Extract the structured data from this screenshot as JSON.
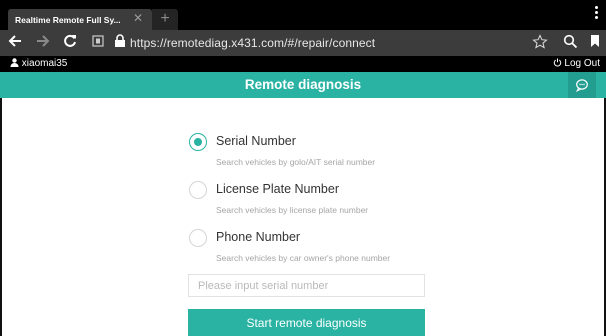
{
  "browser": {
    "tab_title": "Realtime Remote Full Sy...",
    "tab_close_icon": "close-icon",
    "new_tab_icon": "plus-icon",
    "url": "https://remotediag.x431.com/#/repair/connect",
    "icons": [
      "back-arrow-icon",
      "forward-arrow-icon",
      "reload-icon",
      "site-info-icon",
      "lock-icon",
      "star-icon",
      "search-icon",
      "bookmark-icon",
      "menu-icon"
    ]
  },
  "header": {
    "username": "xiaomai35",
    "logout_label": "Log Out",
    "title": "Remote diagnosis"
  },
  "options": [
    {
      "label": "Serial Number",
      "description": "Search vehicles by golo/AIT serial number",
      "selected": true
    },
    {
      "label": "License Plate Number",
      "description": "Search vehicles by license plate number",
      "selected": false
    },
    {
      "label": "Phone Number",
      "description": "Search vehicles by car owner's phone number",
      "selected": false
    }
  ],
  "search": {
    "value": "",
    "placeholder": "Please input serial number"
  },
  "start_button_label": "Start remote diagnosis",
  "colors": {
    "accent": "#2ab3a3",
    "chrome_dark": "#3c3c3c"
  }
}
